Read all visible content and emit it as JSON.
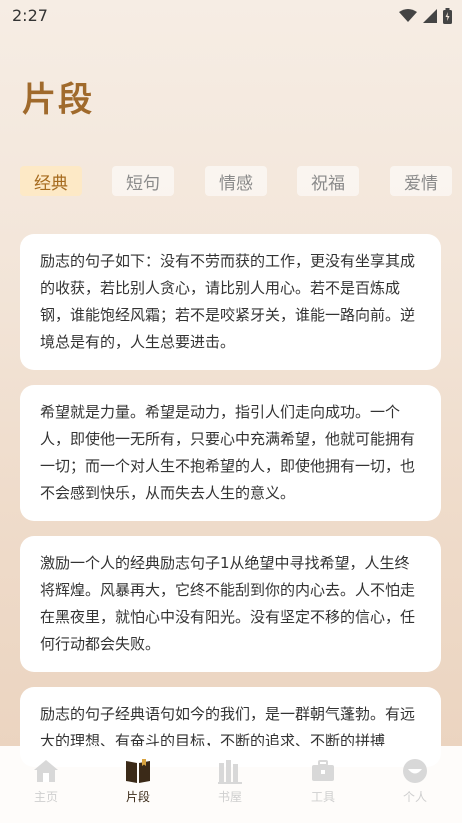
{
  "status": {
    "time": "2:27"
  },
  "header": {
    "title": "片段"
  },
  "tabs": [
    {
      "label": "经典",
      "active": true
    },
    {
      "label": "短句",
      "active": false
    },
    {
      "label": "情感",
      "active": false
    },
    {
      "label": "祝福",
      "active": false
    },
    {
      "label": "爱情",
      "active": false
    }
  ],
  "cards": [
    {
      "text": "励志的句子如下：没有不劳而获的工作，更没有坐享其成的收获，若比别人贪心，请比别人用心。若不是百炼成钢，谁能饱经风霜；若不是咬紧牙关，谁能一路向前。逆境总是有的，人生总要进击。"
    },
    {
      "text": "希望就是力量。希望是动力，指引人们走向成功。一个人，即使他一无所有，只要心中充满希望，他就可能拥有一切；而一个对人生不抱希望的人，即使他拥有一切，也不会感到快乐，从而失去人生的意义。"
    },
    {
      "text": "激励一个人的经典励志句子1从绝望中寻找希望，人生终将辉煌。风暴再大，它终不能刮到你的内心去。人不怕走在黑夜里，就怕心中没有阳光。没有坚定不移的信心，任何行动都会失败。"
    },
    {
      "text": "励志的句子经典语句如今的我们，是一群朝气蓬勃。有远大的理想、有奋斗的目标，不断的追求、不断的拼搏"
    }
  ],
  "nav": [
    {
      "label": "主页",
      "icon": "home-icon",
      "active": false
    },
    {
      "label": "片段",
      "icon": "book-icon",
      "active": true
    },
    {
      "label": "书屋",
      "icon": "bookshelf-icon",
      "active": false
    },
    {
      "label": "工具",
      "icon": "toolbox-icon",
      "active": false
    },
    {
      "label": "个人",
      "icon": "profile-icon",
      "active": false
    }
  ],
  "colors": {
    "accent": "#a06a2c",
    "tab_active_bg": "#fde9c6",
    "nav_active": "#3b2a18",
    "nav_inactive": "#cfcfcf"
  }
}
